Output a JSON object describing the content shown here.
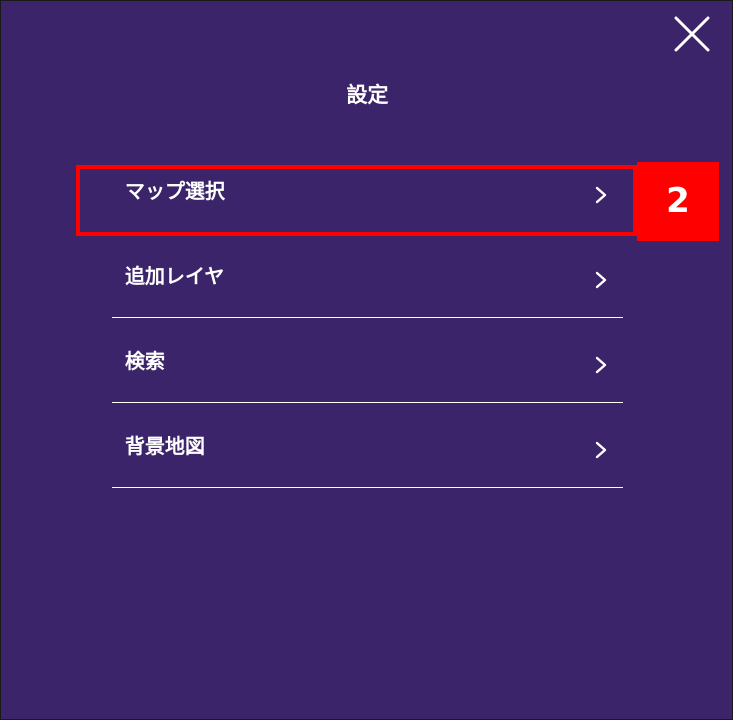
{
  "panel": {
    "title": "設定",
    "close_icon": "close-icon",
    "background_color": "#3b2469"
  },
  "menu": {
    "items": [
      {
        "label": "マップ選択",
        "icon": "chevron-right-icon"
      },
      {
        "label": "追加レイヤ",
        "icon": "chevron-right-icon"
      },
      {
        "label": "検索",
        "icon": "chevron-right-icon"
      },
      {
        "label": "背景地図",
        "icon": "chevron-right-icon"
      }
    ]
  },
  "annotation": {
    "step_number": "2",
    "highlight_color": "#ff0000"
  }
}
